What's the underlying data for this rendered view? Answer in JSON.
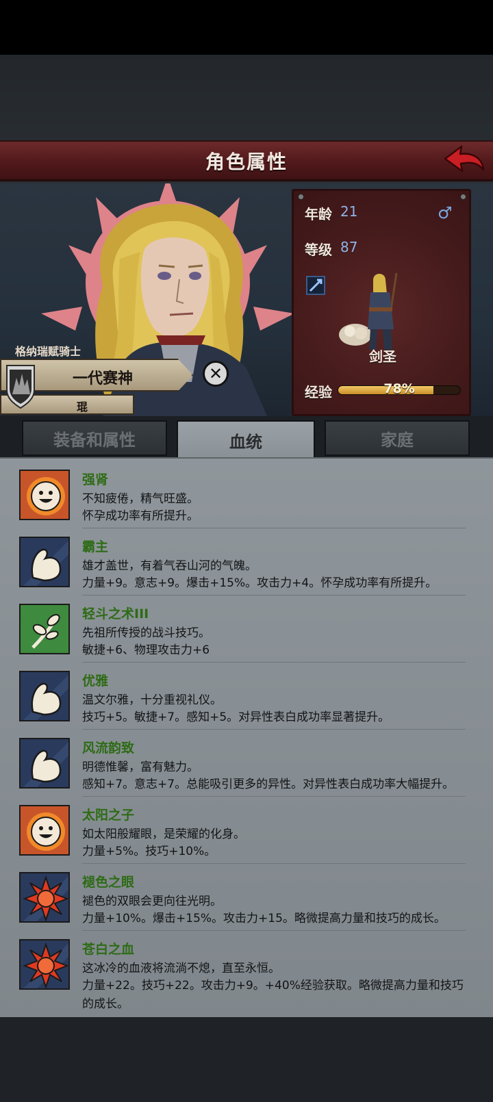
{
  "header": {
    "title": "角色属性"
  },
  "character": {
    "title": "格纳瑞赋骑士",
    "name": "一代赛神",
    "subname": "琨"
  },
  "stats": {
    "age_label": "年龄",
    "age_value": "21",
    "level_label": "等级",
    "level_value": "87",
    "class_name": "剑圣",
    "exp_label": "经验",
    "exp_percent_text": "78%",
    "exp_fraction": 0.78
  },
  "tabs": [
    {
      "label": "装备和属性",
      "active": false
    },
    {
      "label": "血统",
      "active": true
    },
    {
      "label": "家庭",
      "active": false
    }
  ],
  "traits": [
    {
      "icon": "sun-face-icon",
      "name": "强肾",
      "desc": "不知疲倦，精气旺盛。",
      "effect": "怀孕成功率有所提升。"
    },
    {
      "icon": "flexed-arm-icon",
      "name": "霸主",
      "desc": "雄才盖世，有着气吞山河的气魄。",
      "effect": "力量+9。意志+9。爆击+15%。攻击力+4。怀孕成功率有所提升。"
    },
    {
      "icon": "sprout-icon",
      "name": "轻斗之术III",
      "desc": "先祖所传授的战斗技巧。",
      "effect": "敏捷+6、物理攻击力+6"
    },
    {
      "icon": "flexed-arm-icon",
      "name": "优雅",
      "desc": "温文尔雅，十分重视礼仪。",
      "effect": "技巧+5。敏捷+7。感知+5。对异性表白成功率显著提升。"
    },
    {
      "icon": "flexed-arm-icon",
      "name": "风流韵致",
      "desc": "明德惟馨，富有魅力。",
      "effect": "感知+7。意志+7。总能吸引更多的异性。对异性表白成功率大幅提升。"
    },
    {
      "icon": "sun-face-icon",
      "name": "太阳之子",
      "desc": "如太阳般耀眼，是荣耀的化身。",
      "effect": "力量+5%。技巧+10%。"
    },
    {
      "icon": "red-burst-icon",
      "name": "褪色之眼",
      "desc": "褪色的双眼会更向往光明。",
      "effect": "力量+10%。爆击+15%。攻击力+15。略微提高力量和技巧的成长。"
    },
    {
      "icon": "red-burst-icon",
      "name": "苍白之血",
      "desc": "这冰冷的血液将流淌不熄，直至永恒。",
      "effect": "力量+22。技巧+22。攻击力+9。+40%经验获取。略微提高力量和技巧的成长。"
    }
  ],
  "colors": {
    "header": "#5a1f21",
    "trait_name": "#2e6b16",
    "stat_value": "#8fb4e8",
    "exp_fill": "#e0aa45"
  }
}
